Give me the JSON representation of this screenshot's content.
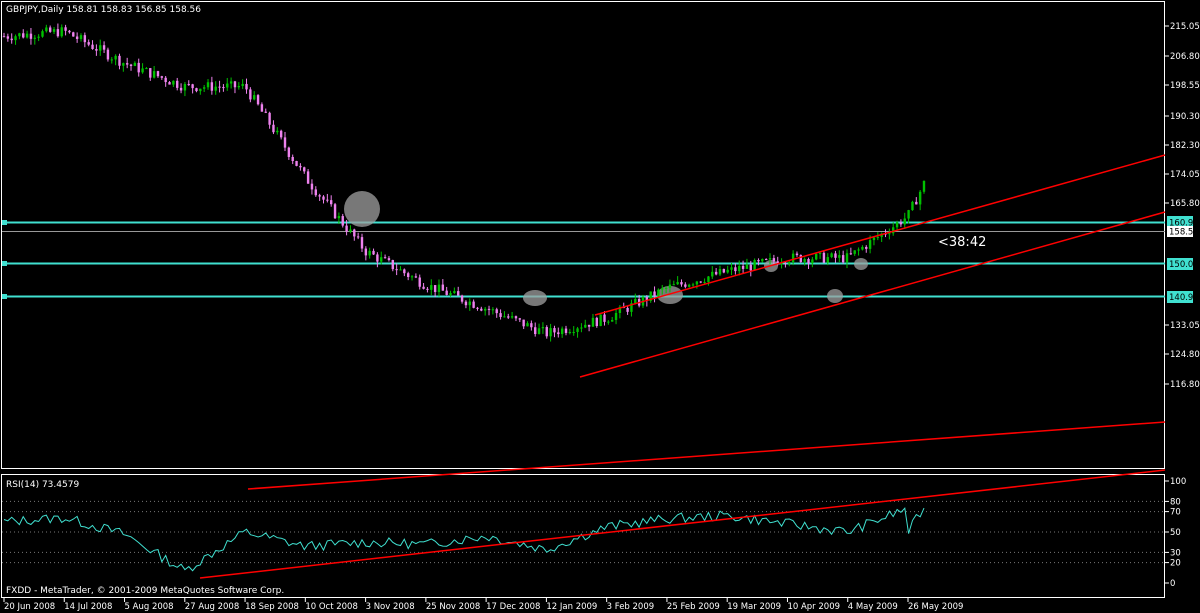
{
  "price_panel": {
    "header": "GBPJPY,Daily  158.81 158.83 156.85 158.56",
    "countdown": "<38:42",
    "current_price_label": "158.56",
    "y_ticks": [
      "215.05",
      "206.80",
      "198.55",
      "190.30",
      "182.30",
      "174.05",
      "165.80",
      "158.56",
      "150.03",
      "140.99",
      "133.05",
      "124.80",
      "116.80"
    ],
    "tick_values": [
      215.05,
      206.8,
      198.55,
      190.3,
      182.3,
      174.05,
      165.8,
      150.03,
      140.99,
      133.05,
      124.8,
      116.8
    ],
    "hline_labels": [
      "160.97",
      "150.03",
      "140.99"
    ]
  },
  "rsi_panel": {
    "header": "RSI(14) 73.4579",
    "y_ticks": [
      "100",
      "80",
      "70",
      "50",
      "30",
      "20",
      "0"
    ]
  },
  "x_axis": {
    "labels": [
      "20 Jun 2008",
      "14 Jul 2008",
      "5 Aug 2008",
      "27 Aug 2008",
      "18 Sep 2008",
      "10 Oct 2008",
      "3 Nov 2008",
      "25 Nov 2008",
      "17 Dec 2008",
      "12 Jan 2009",
      "3 Feb 2009",
      "25 Feb 2009",
      "19 Mar 2009",
      "10 Apr 2009",
      "4 May 2009",
      "26 May 2009"
    ]
  },
  "footer": "FXDD - MetaTrader, © 2001-2009 MetaQuotes Software Corp.",
  "colors": {
    "background": "#000000",
    "grid": "#ffffff",
    "bull_candle": "#00c000",
    "bear_candle": "#ee82ee",
    "hline": "#40e0d0",
    "trendline": "#ff0000",
    "rsi_line": "#40e0d0",
    "highlight_circle": "#a0a0a0"
  },
  "chart_data": [
    {
      "type": "line",
      "title": "GBPJPY,Daily",
      "series": [
        {
          "name": "GBPJPY",
          "x": [
            "20 Jun 2008",
            "14 Jul 2008",
            "5 Aug 2008",
            "27 Aug 2008",
            "18 Sep 2008",
            "10 Oct 2008",
            "3 Nov 2008",
            "25 Nov 2008",
            "17 Dec 2008",
            "12 Jan 2009",
            "3 Feb 2009",
            "25 Feb 2009",
            "19 Mar 2009",
            "10 Apr 2009",
            "4 May 2009",
            "26 May 2009"
          ],
          "values": [
            212.0,
            213.5,
            204.0,
            197.0,
            197.0,
            170.0,
            148.0,
            138.0,
            131.0,
            123.5,
            128.0,
            137.0,
            142.0,
            146.0,
            146.0,
            158.5
          ]
        }
      ],
      "horizontal_lines": [
        160.97,
        150.03,
        140.99
      ],
      "last_price": 158.56,
      "ylim": [
        116.8,
        219.0
      ]
    },
    {
      "type": "line",
      "title": "RSI(14) 73.4579",
      "series": [
        {
          "name": "RSI(14)",
          "x": [
            "20 Jun 2008",
            "14 Jul 2008",
            "5 Aug 2008",
            "27 Aug 2008",
            "18 Sep 2008",
            "10 Oct 2008",
            "3 Nov 2008",
            "25 Nov 2008",
            "17 Dec 2008",
            "12 Jan 2009",
            "3 Feb 2009",
            "25 Feb 2009",
            "19 Mar 2009",
            "10 Apr 2009",
            "4 May 2009",
            "26 May 2009"
          ],
          "values": [
            60,
            64,
            48,
            12,
            50,
            36,
            40,
            38,
            46,
            33,
            55,
            63,
            66,
            58,
            50,
            73.46
          ]
        }
      ],
      "levels": [
        80,
        70,
        50,
        30,
        20
      ],
      "ylim": [
        0,
        100
      ]
    }
  ]
}
